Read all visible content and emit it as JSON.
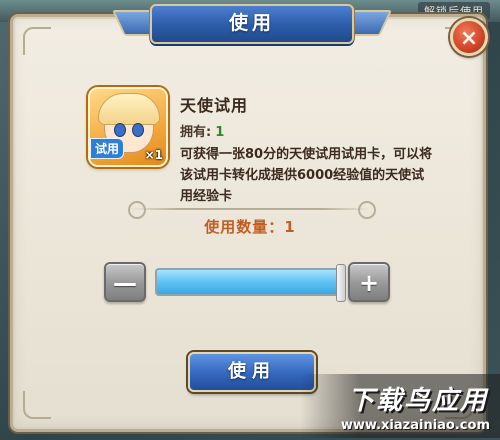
{
  "background": {
    "unlock_text": "解锁后使用"
  },
  "dialog": {
    "title": "使用",
    "close_symbol": "×"
  },
  "item": {
    "name": "天使试用",
    "owned_label": "拥有:",
    "owned_value": "1",
    "description": "可获得一张80分的天使试用试用卡，可以将该试用卡转化成提供6000经验值的天使试用经验卡",
    "icon_tag": "试用",
    "icon_qty": "×1",
    "icon_name": "angel-portrait-icon"
  },
  "usage": {
    "label": "使用数量：1",
    "quantity": 1,
    "slider_fraction": 1.0
  },
  "controls": {
    "minus_symbol": "—",
    "plus_symbol": "+",
    "use_button": "使用"
  },
  "watermark": {
    "title": "下载鸟应用",
    "url": "www.xiazainiao.com"
  },
  "colors": {
    "accent_blue": "#2c5ca8",
    "owned_green": "#2f8a22",
    "count_orange": "#c25e22",
    "close_red": "#d4472b"
  }
}
